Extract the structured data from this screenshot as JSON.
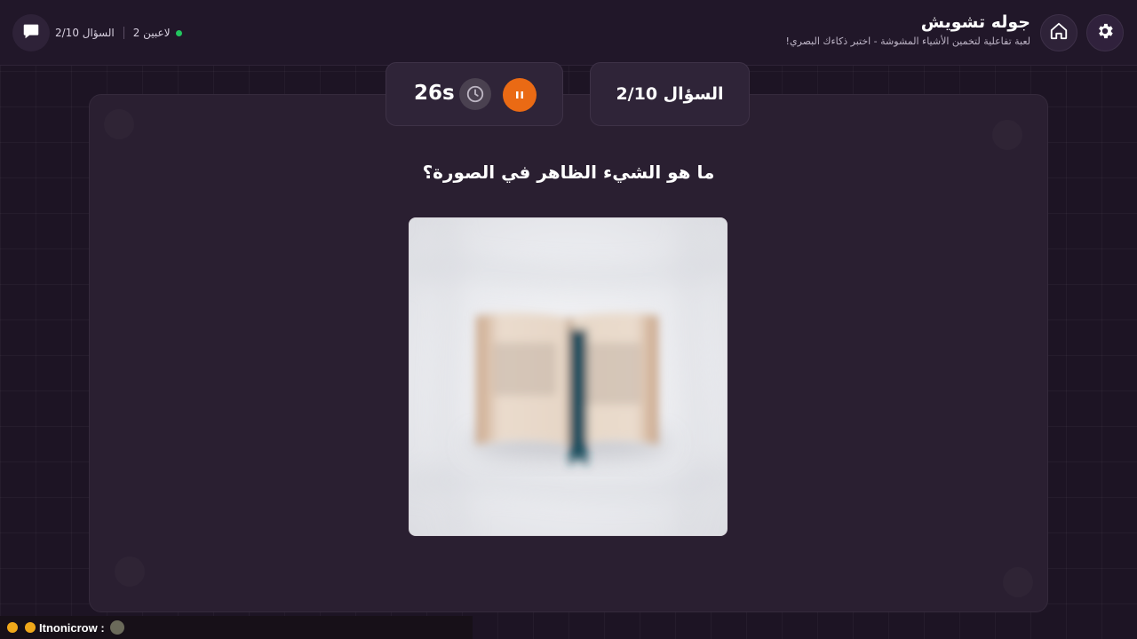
{
  "header": {
    "title": "جوله تشويش",
    "subtitle": "لعبة تفاعلية لتخمين الأشياء المشوشة - اختبر ذكاءك البصري!",
    "players": "2 لاعبين",
    "question_progress": "السؤال 2/10",
    "icons": {
      "settings": "gear-icon",
      "home": "home-icon",
      "chat": "chat-bubble-icon"
    },
    "online_color": "#22c55e"
  },
  "game": {
    "timer": "26s",
    "question_badge": "السؤال 2/10",
    "question_text": "ما هو الشيء الظاهر في الصورة؟",
    "pause_color": "#ea6a14",
    "image_subject": "blurred-open-book-with-bookmark"
  },
  "chat": {
    "username": "Itnonicrow :"
  }
}
